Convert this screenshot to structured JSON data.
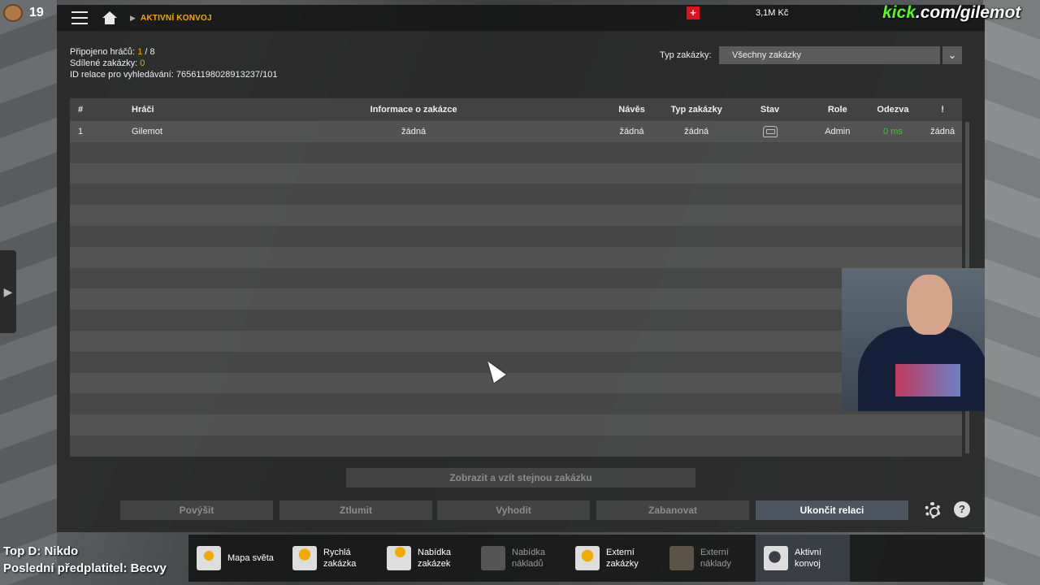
{
  "top_left": {
    "count": "19"
  },
  "header": {
    "breadcrumb": "AKTIVNÍ KONVOJ",
    "flag_glyph": "+",
    "money": "3,1M Kč"
  },
  "watermark": {
    "prefix": "kick",
    "rest": ".com/gilemot"
  },
  "info": {
    "connected_label": "Připojeno hráčů:",
    "connected_value": "1",
    "connected_max": "/ 8",
    "shared_label": "Sdílené zakázky:",
    "shared_value": "0",
    "session_label": "ID relace pro vyhledávání:",
    "session_value": "76561198028913237/101"
  },
  "filter": {
    "label": "Typ zakázky:",
    "selected": "Všechny zakázky",
    "chevron": "⌄"
  },
  "table": {
    "headers": {
      "num": "#",
      "player": "Hráči",
      "info": "Informace o zakázce",
      "trailer": "Návěs",
      "type": "Typ zakázky",
      "status": "Stav",
      "role": "Role",
      "ping": "Odezva",
      "excl": "!"
    },
    "rows": [
      {
        "num": "1",
        "player": "Gilemot",
        "info": "žádná",
        "trailer": "žádná",
        "type": "žádná",
        "role": "Admin",
        "ping": "0 ms",
        "excl": "žádná"
      }
    ]
  },
  "buttons": {
    "take_same": "Zobrazit a vzít stejnou zakázku",
    "promote": "Povýšit",
    "mute": "Ztlumit",
    "kick": "Vyhodit",
    "ban": "Zabanovat",
    "end": "Ukončit relaci",
    "help": "?"
  },
  "stream": {
    "top_d": "Top D: Nikdo",
    "last_sub": "Poslední předplatitel: Becvy"
  },
  "nav": [
    {
      "l1": "Mapa světa",
      "l2": ""
    },
    {
      "l1": "Rychlá",
      "l2": "zakázka"
    },
    {
      "l1": "Nabídka",
      "l2": "zakázek"
    },
    {
      "l1": "Nabídka",
      "l2": "nákladů"
    },
    {
      "l1": "Externí",
      "l2": "zakázky"
    },
    {
      "l1": "Externí",
      "l2": "náklady"
    },
    {
      "l1": "Aktivní",
      "l2": "konvoj"
    }
  ],
  "colors": {
    "accent": "#f2a900",
    "ping_good": "#3fc63f",
    "kick_green": "#53fc18",
    "flag_red": "#e0101a"
  }
}
